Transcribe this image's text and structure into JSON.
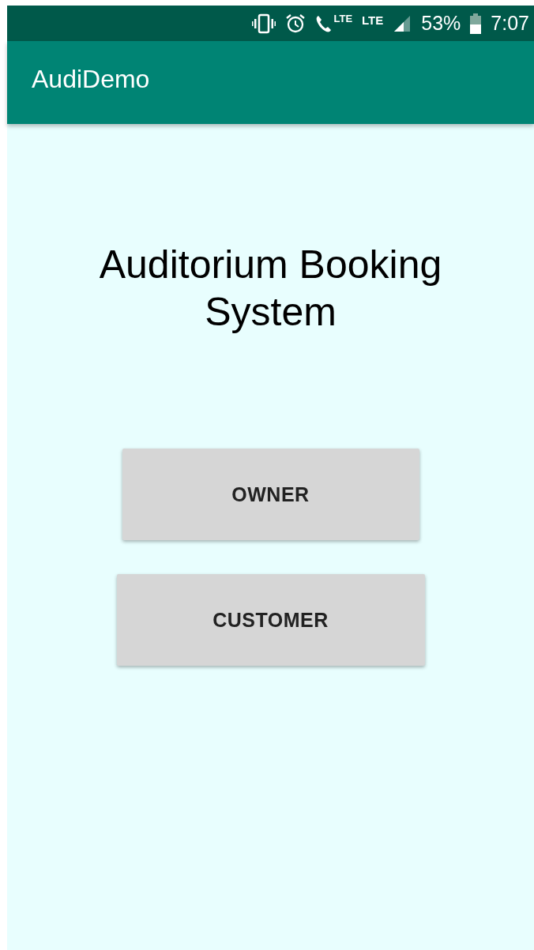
{
  "status_bar": {
    "call_network": "LTE",
    "network": "LTE",
    "battery": "53%",
    "time": "7:07"
  },
  "app_bar": {
    "title": "AudiDemo"
  },
  "heading": "Auditorium Booking System",
  "buttons": [
    {
      "label": "OWNER",
      "kind": "narrow"
    },
    {
      "label": "CUSTOMER",
      "kind": "wide"
    }
  ]
}
